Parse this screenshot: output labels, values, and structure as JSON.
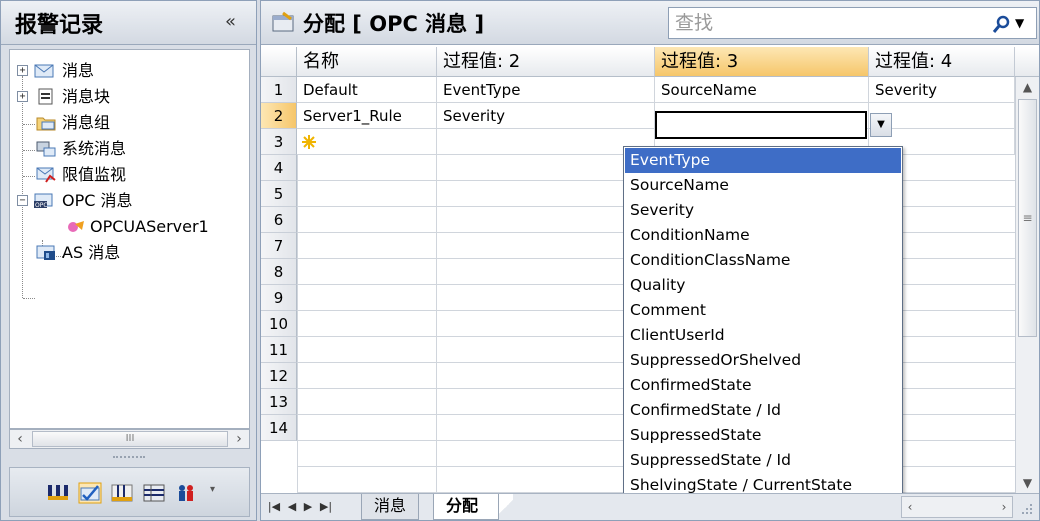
{
  "left_panel": {
    "title": "报警记录",
    "collapse_glyph": "«",
    "tree": [
      {
        "label": "消息",
        "icon": "envelope-icon",
        "expander": "+"
      },
      {
        "label": "消息块",
        "icon": "list-icon",
        "expander": "+"
      },
      {
        "label": "消息组",
        "icon": "folder-envelope-icon"
      },
      {
        "label": "系统消息",
        "icon": "system-message-icon"
      },
      {
        "label": "限值监视",
        "icon": "limit-monitor-icon"
      },
      {
        "label": "OPC 消息",
        "icon": "opc-icon",
        "expander": "−"
      },
      {
        "label": "OPCUAServer1",
        "icon": "server-icon"
      },
      {
        "label": "AS 消息",
        "icon": "as-message-icon"
      }
    ],
    "hscroll_thumb": "III"
  },
  "editor": {
    "title": "分配 [ OPC 消息 ]",
    "search_placeholder": "查找",
    "columns": [
      "名称",
      "过程值: 2",
      "过程值: 3",
      "过程值: 4"
    ],
    "rows": [
      {
        "num": "1",
        "name": "Default",
        "pv2": "EventType",
        "pv3": "SourceName",
        "pv4": "Severity"
      },
      {
        "num": "2",
        "name": "Server1_Rule",
        "pv2": "Severity",
        "pv3": "",
        "pv4": ""
      },
      {
        "num": "3",
        "name": "",
        "pv2": "",
        "pv3": "",
        "pv4": ""
      },
      {
        "num": "4"
      },
      {
        "num": "5"
      },
      {
        "num": "6"
      },
      {
        "num": "7"
      },
      {
        "num": "8"
      },
      {
        "num": "9"
      },
      {
        "num": "10"
      },
      {
        "num": "11"
      },
      {
        "num": "12"
      },
      {
        "num": "13"
      },
      {
        "num": "14"
      }
    ],
    "dropdown_options": [
      "EventType",
      "SourceName",
      "Severity",
      "ConditionName",
      "ConditionClassName",
      "Quality",
      "Comment",
      "ClientUserId",
      "SuppressedOrShelved",
      "ConfirmedState",
      "ConfirmedState / Id",
      "SuppressedState",
      "SuppressedState / Id",
      "ShelvingState / CurrentState"
    ],
    "selected_option": "EventType",
    "tabs": [
      {
        "label": "消息",
        "active": false
      },
      {
        "label": "分配",
        "active": true
      }
    ],
    "nav_glyphs": [
      "|◀",
      "◀",
      "▶",
      "▶|"
    ]
  },
  "colors": {
    "accent_selected": "#3e6dc6",
    "header_highlight": "#f6c66a",
    "panel_bg": "#d9dee6"
  }
}
